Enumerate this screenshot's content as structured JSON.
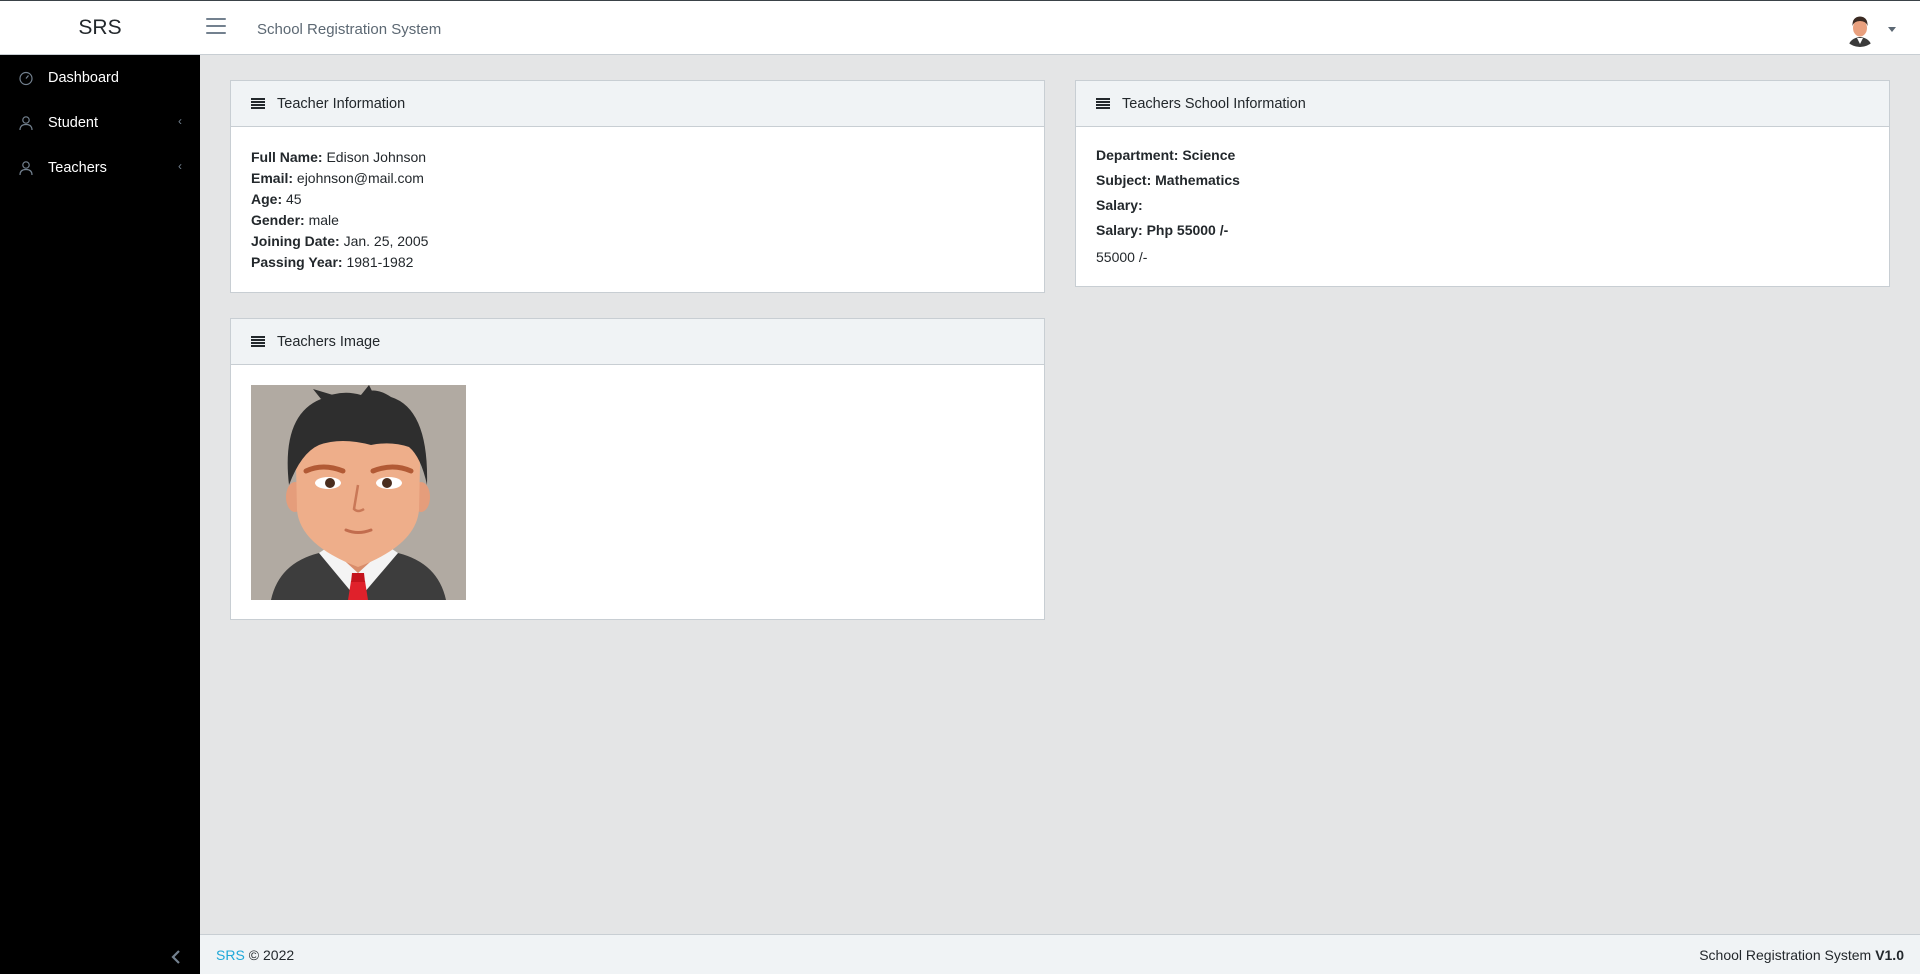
{
  "header": {
    "brand": "SRS",
    "title": "School Registration System"
  },
  "sidebar": {
    "items": [
      {
        "label": "Dashboard"
      },
      {
        "label": "Student"
      },
      {
        "label": "Teachers"
      }
    ]
  },
  "teacher_info": {
    "header": "Teacher Information",
    "fields": [
      {
        "label": "Full Name:",
        "value": "Edison Johnson"
      },
      {
        "label": "Email:",
        "value": "ejohnson@mail.com"
      },
      {
        "label": "Age:",
        "value": "45"
      },
      {
        "label": "Gender:",
        "value": "male"
      },
      {
        "label": "Joining Date:",
        "value": "Jan. 25, 2005"
      },
      {
        "label": "Passing Year:",
        "value": "1981-1982"
      }
    ]
  },
  "school_info": {
    "header": "Teachers School Information",
    "department": "Department: Science",
    "subject": "Subject: Mathematics",
    "salary": "Salary:",
    "salary_php": "Salary: Php 55000 /-",
    "salary_plain": "55000 /-"
  },
  "teacher_image": {
    "header": "Teachers Image"
  },
  "footer": {
    "brand_link": "SRS",
    "copyright": "© 2022",
    "system_name": "School Registration System",
    "version": "V1.0"
  },
  "colors": {
    "accent": "#20a8d8",
    "sidebar_bg": "#000000",
    "page_bg": "#e4e5e6"
  },
  "icons": {
    "menu": "hamburger-icon",
    "dashboard": "speedometer-icon",
    "student": "user-icon",
    "teachers": "user-icon",
    "card_header": "list-icon",
    "sidebar_minimize": "chevron-left-icon"
  }
}
